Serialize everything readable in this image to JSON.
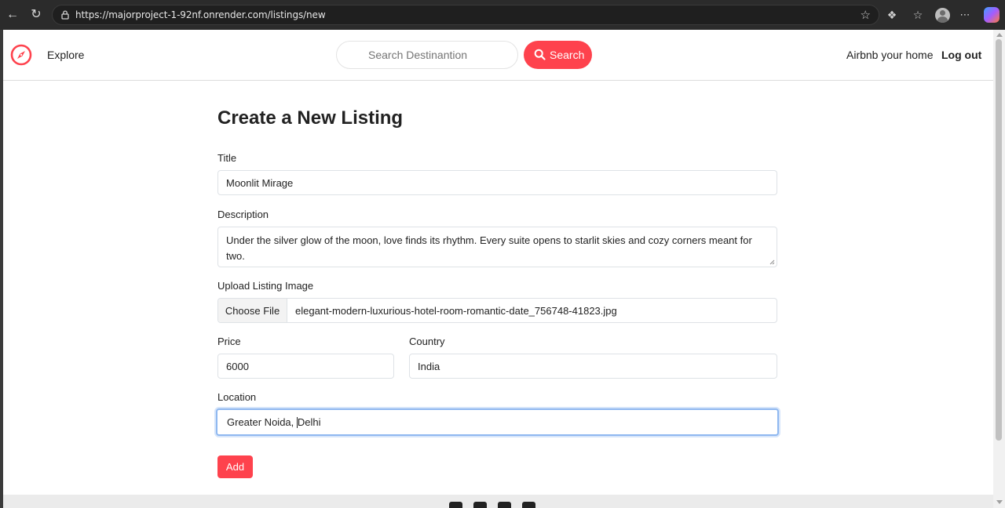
{
  "browser": {
    "url": "https://majorproject-1-92nf.onrender.com/listings/new",
    "icons": [
      "back-arrow-icon",
      "refresh-icon",
      "lock-icon",
      "favorite-star-icon",
      "extensions-icon",
      "favorites-icon",
      "profile-avatar",
      "more-icon",
      "copilot-icon"
    ]
  },
  "navbar": {
    "explore_label": "Explore",
    "search_placeholder": "Search Destinantion",
    "search_button_label": "Search",
    "host_label": "Airbnb your home",
    "logout_label": "Log out",
    "brand_color": "#fe424d"
  },
  "form": {
    "heading": "Create a New Listing",
    "title_label": "Title",
    "title_value": "Moonlit Mirage",
    "description_label": "Description",
    "description_value": "Under the silver glow of the moon, love finds its rhythm. Every suite opens to starlit skies and cozy corners meant for two.",
    "image_label": "Upload Listing Image",
    "choose_file_label": "Choose File",
    "file_name": "elegant-modern-luxurious-hotel-room-romantic-date_756748-41823.jpg",
    "price_label": "Price",
    "price_value": "6000",
    "country_label": "Country",
    "country_value": "India",
    "location_label": "Location",
    "location_value_before_caret": "Greater Noida, ",
    "location_value_after_caret": "Delhi",
    "submit_label": "Add"
  },
  "footer": {
    "social_icons": [
      "facebook-icon",
      "instagram-icon",
      "twitter-icon",
      "linkedin-icon"
    ]
  }
}
